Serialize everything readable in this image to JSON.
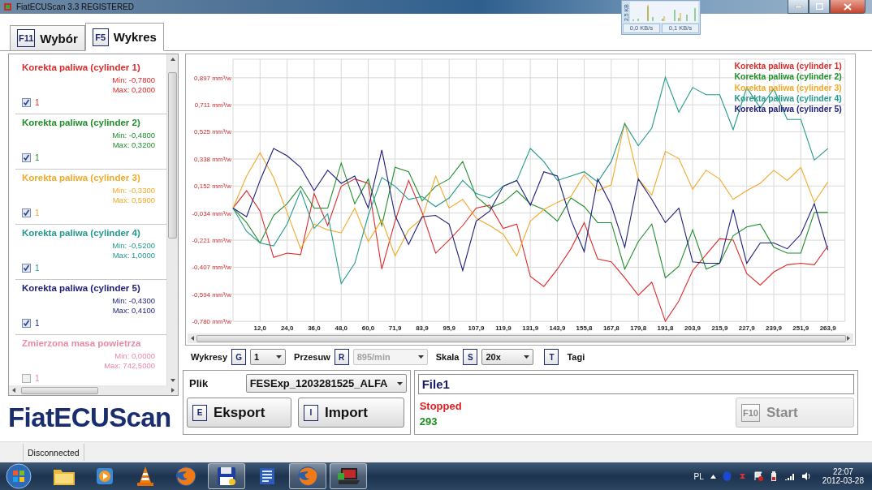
{
  "window": {
    "title": "FiatECUScan 3.3 REGISTERED"
  },
  "network_monitor": {
    "scale": "2,5 KB",
    "down": "0,0 KB/s",
    "up": "0,1 KB/s"
  },
  "tabs": [
    {
      "key": "F11",
      "label": "Wybór",
      "selected": false
    },
    {
      "key": "F5",
      "label": "Wykres",
      "selected": true
    }
  ],
  "parameters": [
    {
      "name": "Korekta paliwa (cylinder 1)",
      "min": "Min: -0,7800",
      "max": "Max: 0,2000",
      "checked": true,
      "count": "1",
      "color": "#e02828"
    },
    {
      "name": "Korekta paliwa (cylinder 2)",
      "min": "Min: -0,4800",
      "max": "Max: 0,3200",
      "checked": true,
      "count": "1",
      "color": "#1f8f2a"
    },
    {
      "name": "Korekta paliwa (cylinder 3)",
      "min": "Min: -0,3300",
      "max": "Max: 0,5900",
      "checked": true,
      "count": "1",
      "color": "#f2a928"
    },
    {
      "name": "Korekta paliwa (cylinder 4)",
      "min": "Min: -0,5200",
      "max": "Max: 1,0000",
      "checked": true,
      "count": "1",
      "color": "#229a8c"
    },
    {
      "name": "Korekta paliwa (cylinder 5)",
      "min": "Min: -0,4300",
      "max": "Max: 0,4100",
      "checked": true,
      "count": "1",
      "color": "#1c1c7a"
    },
    {
      "name": "Zmierzona masa powietrza",
      "min": "Min: 0,0000",
      "max": "Max: 742,5000",
      "checked": false,
      "count": "1",
      "color": "#e88aa4"
    }
  ],
  "logo": "FiatECUScan",
  "chart": {
    "chart_data": {
      "type": "line",
      "grid": true,
      "x": [
        0,
        6,
        12,
        18,
        24,
        30,
        36,
        42,
        48,
        54,
        60,
        66,
        71.9,
        77.9,
        83.9,
        89.9,
        95.9,
        101.9,
        107.9,
        113.9,
        119.9,
        125.9,
        131.9,
        137.9,
        143.9,
        149.9,
        155.8,
        161.8,
        167.8,
        173.8,
        179.8,
        185.8,
        191.8,
        197.8,
        203.9,
        209.9,
        215.9,
        221.9,
        227.9,
        233.9,
        239.9,
        245.9,
        251.9,
        257.9,
        263.9
      ],
      "xlim": [
        0,
        271.5
      ],
      "ylim": [
        -0.78,
        1.025
      ],
      "xticks": [
        {
          "value": 12,
          "label": "12,0"
        },
        {
          "value": 24,
          "label": "24,0"
        },
        {
          "value": 36,
          "label": "36,0"
        },
        {
          "value": 48,
          "label": "48,0"
        },
        {
          "value": 60,
          "label": "60,0"
        },
        {
          "value": 71.9,
          "label": "71,9"
        },
        {
          "value": 83.9,
          "label": "83,9"
        },
        {
          "value": 95.9,
          "label": "95,9"
        },
        {
          "value": 107.9,
          "label": "107,9"
        },
        {
          "value": 119.9,
          "label": "119,9"
        },
        {
          "value": 131.9,
          "label": "131,9"
        },
        {
          "value": 143.9,
          "label": "143,9"
        },
        {
          "value": 155.8,
          "label": "155,8"
        },
        {
          "value": 167.8,
          "label": "167,8"
        },
        {
          "value": 179.8,
          "label": "179,8"
        },
        {
          "value": 191.8,
          "label": "191,8"
        },
        {
          "value": 203.9,
          "label": "203,9"
        },
        {
          "value": 215.9,
          "label": "215,9"
        },
        {
          "value": 227.9,
          "label": "227,9"
        },
        {
          "value": 239.9,
          "label": "239,9"
        },
        {
          "value": 251.9,
          "label": "251,9"
        },
        {
          "value": 263.9,
          "label": "263,9"
        }
      ],
      "yticks": [
        {
          "value": 0.897,
          "label": "0,897 mm³/w"
        },
        {
          "value": 0.711,
          "label": "0,711 mm³/w"
        },
        {
          "value": 0.525,
          "label": "0,525 mm³/w"
        },
        {
          "value": 0.338,
          "label": "0,338 mm³/w"
        },
        {
          "value": 0.152,
          "label": "0,152 mm³/w"
        },
        {
          "value": -0.034,
          "label": "-0,034 mm³/w"
        },
        {
          "value": -0.221,
          "label": "-0,221 mm³/w"
        },
        {
          "value": -0.407,
          "label": "-0,407 mm³/w"
        },
        {
          "value": -0.594,
          "label": "-0,594 mm³/w"
        },
        {
          "value": -0.78,
          "label": "-0,780 mm³/w"
        }
      ],
      "series": [
        {
          "name": "Korekta paliwa (cylinder 1)",
          "color": "#e02828",
          "values": [
            0.0,
            0.12,
            -0.02,
            -0.34,
            -0.31,
            -0.32,
            0.1,
            -0.12,
            0.15,
            0.2,
            0.17,
            -0.42,
            -0.09,
            0.19,
            -0.03,
            -0.31,
            -0.22,
            -0.12,
            0.0,
            0.02,
            -0.14,
            -0.11,
            -0.47,
            -0.54,
            -0.42,
            -0.28,
            -0.1,
            -0.35,
            -0.37,
            -0.48,
            -0.6,
            -0.51,
            -0.78,
            -0.64,
            -0.43,
            -0.32,
            -0.21,
            -0.22,
            -0.45,
            -0.53,
            -0.44,
            -0.39,
            -0.38,
            -0.39,
            -0.26
          ]
        },
        {
          "name": "Korekta paliwa (cylinder 2)",
          "color": "#1f8f2a",
          "values": [
            0.0,
            -0.1,
            -0.24,
            -0.05,
            0.03,
            0.15,
            0.0,
            0.0,
            0.31,
            0.03,
            0.2,
            -0.12,
            0.28,
            0.25,
            0.05,
            0.15,
            0.2,
            0.32,
            0.08,
            0.0,
            0.04,
            0.12,
            0.03,
            -0.01,
            -0.09,
            0.07,
            0.01,
            -0.1,
            -0.1,
            -0.42,
            -0.23,
            -0.11,
            -0.48,
            -0.4,
            -0.15,
            -0.42,
            -0.38,
            -0.19,
            -0.13,
            -0.11,
            -0.27,
            -0.31,
            -0.31,
            -0.03,
            -0.03
          ]
        },
        {
          "name": "Korekta paliwa (cylinder 3)",
          "color": "#f2a928",
          "values": [
            0.0,
            0.22,
            0.38,
            0.21,
            -0.03,
            -0.28,
            -0.11,
            -0.15,
            -0.17,
            0.0,
            -0.23,
            -0.08,
            -0.33,
            -0.15,
            -0.07,
            0.22,
            0.0,
            0.06,
            -0.07,
            -0.12,
            -0.18,
            -0.33,
            -0.09,
            -0.01,
            0.04,
            0.08,
            0.23,
            0.12,
            0.16,
            0.59,
            0.2,
            0.09,
            0.39,
            0.34,
            0.13,
            0.26,
            0.2,
            0.06,
            0.12,
            0.17,
            0.26,
            0.19,
            0.28,
            0.04,
            0.18
          ]
        },
        {
          "name": "Korekta paliwa (cylinder 4)",
          "color": "#229a8c",
          "values": [
            0.0,
            -0.16,
            -0.24,
            -0.26,
            -0.11,
            0.12,
            -0.14,
            -0.04,
            -0.52,
            -0.38,
            -0.05,
            0.21,
            0.15,
            0.06,
            0.08,
            0.01,
            0.07,
            0.19,
            0.1,
            0.07,
            0.15,
            0.19,
            0.41,
            0.32,
            0.19,
            0.22,
            0.25,
            0.18,
            0.32,
            0.58,
            0.43,
            0.55,
            0.9,
            0.66,
            0.83,
            0.78,
            0.78,
            0.54,
            0.83,
            0.69,
            0.82,
            0.61,
            0.61,
            0.33,
            0.41
          ]
        },
        {
          "name": "Korekta paliwa (cylinder 5)",
          "color": "#1c1c7a",
          "values": [
            0.0,
            -0.06,
            0.19,
            0.41,
            0.36,
            0.28,
            0.12,
            0.26,
            0.17,
            0.22,
            0.0,
            0.4,
            -0.05,
            -0.25,
            -0.06,
            -0.05,
            -0.11,
            -0.43,
            -0.09,
            -0.02,
            0.15,
            0.19,
            0.02,
            0.25,
            0.22,
            -0.08,
            -0.3,
            0.2,
            0.02,
            -0.27,
            0.2,
            0.06,
            -0.1,
            0.0,
            -0.37,
            -0.38,
            -0.38,
            -0.01,
            -0.38,
            -0.24,
            -0.24,
            -0.28,
            -0.18,
            0.03,
            -0.29
          ]
        }
      ]
    }
  },
  "controls": [
    {
      "kind": "select",
      "label": "Wykresy",
      "key": "G",
      "value": "1",
      "disabled": false
    },
    {
      "kind": "select",
      "label": "Przesuw",
      "key": "R",
      "value": "895/min",
      "disabled": true
    },
    {
      "kind": "select",
      "label": "Skala",
      "key": "S",
      "value": "20x",
      "disabled": false
    },
    {
      "kind": "toggle",
      "label": "Tagi",
      "key": "T"
    }
  ],
  "file": {
    "label": "Plik",
    "value": "FESExp_1203281525_ALFA"
  },
  "buttons": [
    {
      "key": "E",
      "label": "Eksport"
    },
    {
      "key": "I",
      "label": "Import"
    }
  ],
  "session": {
    "name": "File1",
    "status": "Stopped",
    "count": "293",
    "start": {
      "key": "F10",
      "label": "Start",
      "disabled": true
    }
  },
  "status_bar": {
    "text": "Disconnected"
  },
  "taskbar": {
    "apps": [
      {
        "kind": "folder",
        "running": false
      },
      {
        "kind": "player",
        "running": false
      },
      {
        "kind": "cone",
        "running": false
      },
      {
        "kind": "browser",
        "running": false
      },
      {
        "kind": "floppy",
        "running": true
      },
      {
        "kind": "document",
        "running": false
      },
      {
        "kind": "browser",
        "running": true
      },
      {
        "kind": "laptop",
        "running": true
      }
    ],
    "language": "PL",
    "time": "22:07",
    "date": "2012-03-28"
  }
}
